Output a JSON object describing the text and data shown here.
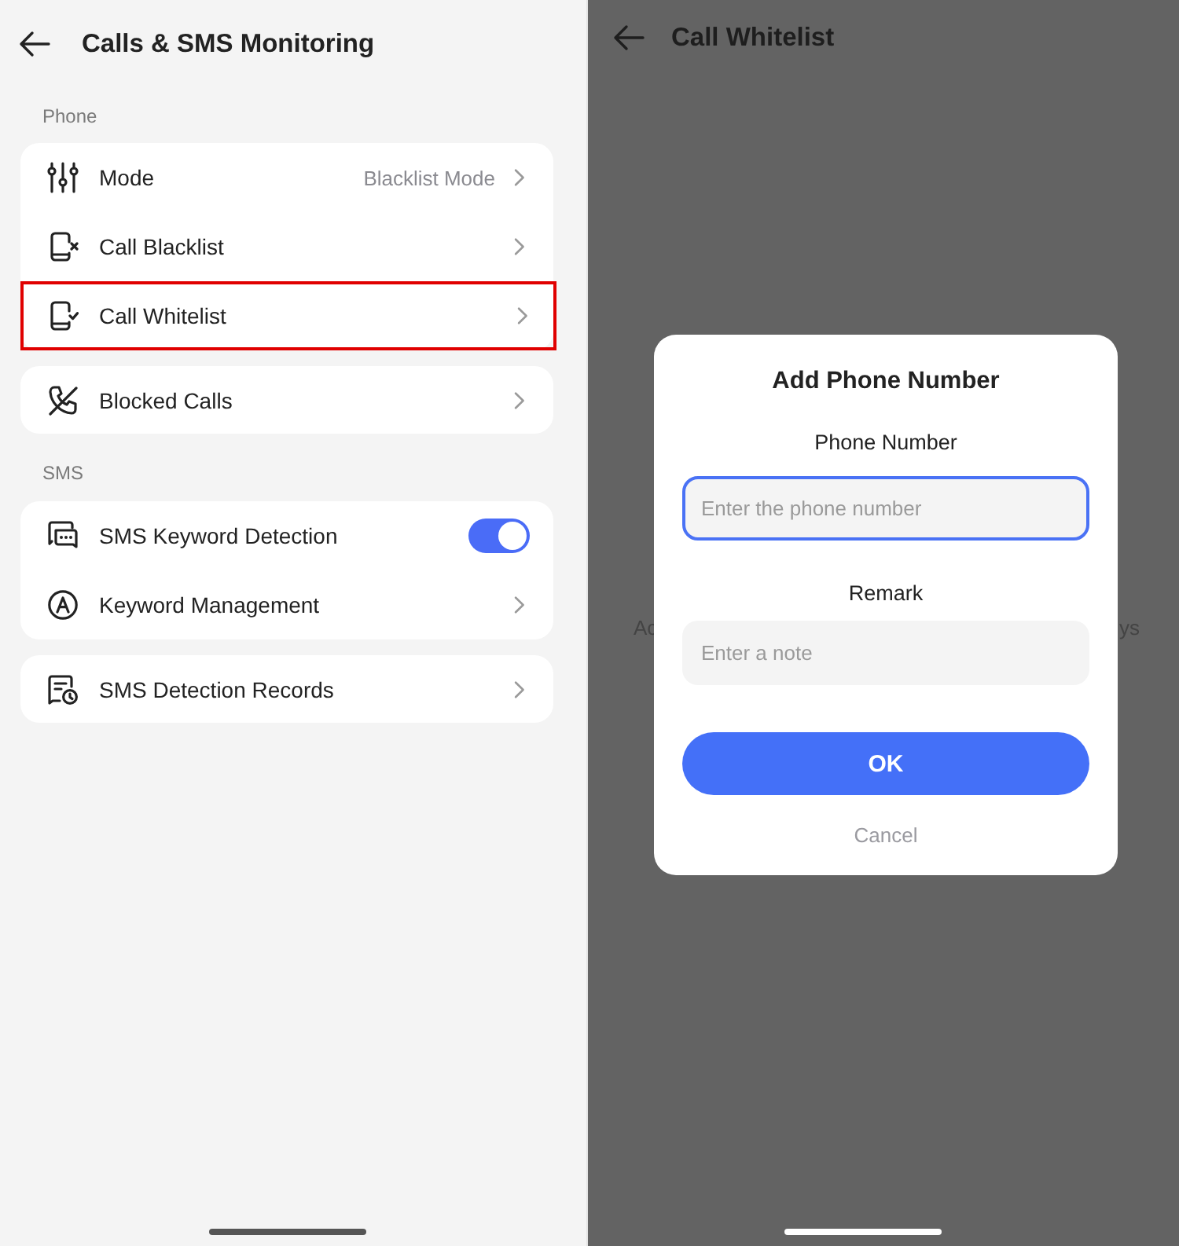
{
  "settings_screen": {
    "title": "Calls & SMS Monitoring",
    "sections": [
      {
        "label": "Phone",
        "cards": [
          {
            "rows": [
              {
                "kind": "nav",
                "label": "Mode",
                "value": "Blacklist Mode",
                "highlighted": false
              },
              {
                "kind": "nav",
                "label": "Call Blacklist",
                "highlighted": false
              },
              {
                "kind": "nav",
                "label": "Call Whitelist",
                "highlighted": true
              }
            ]
          },
          {
            "rows": [
              {
                "kind": "nav",
                "label": "Blocked Calls",
                "highlighted": false
              }
            ]
          }
        ]
      },
      {
        "label": "SMS",
        "cards": [
          {
            "rows": [
              {
                "kind": "toggle",
                "label": "SMS Keyword Detection",
                "on": true,
                "highlighted": false
              },
              {
                "kind": "nav",
                "label": "Keyword Management",
                "highlighted": false
              }
            ]
          },
          {
            "rows": [
              {
                "kind": "nav",
                "label": "SMS Detection Records",
                "highlighted": false
              }
            ]
          }
        ]
      }
    ]
  },
  "whitelist_screen": {
    "title": "Call Whitelist",
    "background_text_fragments": [
      "Ac",
      "ys"
    ],
    "dialog": {
      "title": "Add Phone Number",
      "fields": [
        {
          "label": "Phone Number",
          "placeholder": "Enter the phone number",
          "focused": true
        },
        {
          "label": "Remark",
          "placeholder": "Enter a note",
          "focused": false
        }
      ],
      "ok_button": "OK",
      "cancel_button": "Cancel"
    }
  }
}
